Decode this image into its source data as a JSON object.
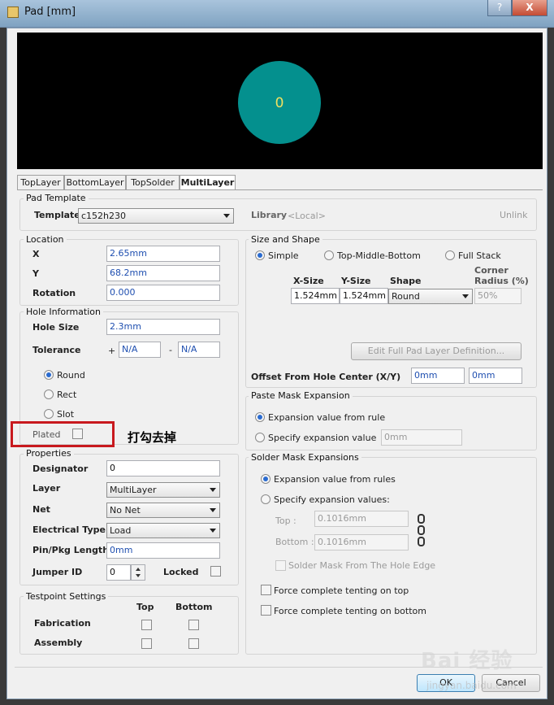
{
  "window": {
    "title": "Pad [mm]",
    "help_label": "?",
    "close_label": "X"
  },
  "preview": {
    "pad_label": "0",
    "pad_color": "#04908e",
    "background": "#000000"
  },
  "tabs": [
    "TopLayer",
    "BottomLayer",
    "TopSolder",
    "MultiLayer"
  ],
  "active_tab": "MultiLayer",
  "pad_template": {
    "group": "Pad Template",
    "template_label": "Template",
    "template_value": "c152h230",
    "library_label": "Library",
    "library_value": "<Local>",
    "unlink_label": "Unlink"
  },
  "location": {
    "group": "Location",
    "x_label": "X",
    "x_value": "2.65mm",
    "y_label": "Y",
    "y_value": "68.2mm",
    "rotation_label": "Rotation",
    "rotation_value": "0.000"
  },
  "hole": {
    "group": "Hole Information",
    "size_label": "Hole Size",
    "size_value": "2.3mm",
    "tolerance_label": "Tolerance",
    "tol_plus": "+",
    "tol_plus_value": "N/A",
    "tol_minus": "-",
    "tol_minus_value": "N/A",
    "shapes": [
      "Round",
      "Rect",
      "Slot"
    ],
    "selected_shape": "Round",
    "plated_label": "Plated",
    "annotation": "打勾去掉"
  },
  "properties": {
    "group": "Properties",
    "designator_label": "Designator",
    "designator_value": "0",
    "layer_label": "Layer",
    "layer_value": "MultiLayer",
    "net_label": "Net",
    "net_value": "No Net",
    "etype_label": "Electrical Type",
    "etype_value": "Load",
    "pinpkg_label": "Pin/Pkg Length",
    "pinpkg_value": "0mm",
    "jumper_label": "Jumper ID",
    "jumper_value": "0",
    "locked_label": "Locked"
  },
  "testpoint": {
    "group": "Testpoint Settings",
    "col_top": "Top",
    "col_bottom": "Bottom",
    "fabrication_label": "Fabrication",
    "assembly_label": "Assembly"
  },
  "size_shape": {
    "group": "Size and Shape",
    "modes": [
      "Simple",
      "Top-Middle-Bottom",
      "Full Stack"
    ],
    "selected_mode": "Simple",
    "xsize_label": "X-Size",
    "ysize_label": "Y-Size",
    "shape_label": "Shape",
    "corner_label_1": "Corner",
    "corner_label_2": "Radius (%)",
    "xsize_value": "1.524mm",
    "ysize_value": "1.524mm",
    "shape_value": "Round",
    "corner_value": "50%",
    "edit_button": "Edit Full Pad Layer Definition...",
    "offset_label": "Offset From Hole Center (X/Y)",
    "offset_x": "0mm",
    "offset_y": "0mm"
  },
  "paste_mask": {
    "group": "Paste Mask Expansion",
    "opt1": "Expansion value from rule",
    "opt2": "Specify expansion value",
    "value": "0mm"
  },
  "solder_mask": {
    "group": "Solder Mask Expansions",
    "opt1": "Expansion value from rules",
    "opt2": "Specify expansion values:",
    "top_label": "Top :",
    "top_value": "0.1016mm",
    "bottom_label": "Bottom :",
    "bottom_value": "0.1016mm",
    "hole_edge_label": "Solder Mask From The Hole Edge",
    "tent_top_label": "Force complete tenting on top",
    "tent_bottom_label": "Force complete tenting on bottom"
  },
  "footer": {
    "ok_label": "OK",
    "cancel_label": "Cancel",
    "watermark": "Bai 经验",
    "watermark_url": "jingyan.baidu.com"
  }
}
